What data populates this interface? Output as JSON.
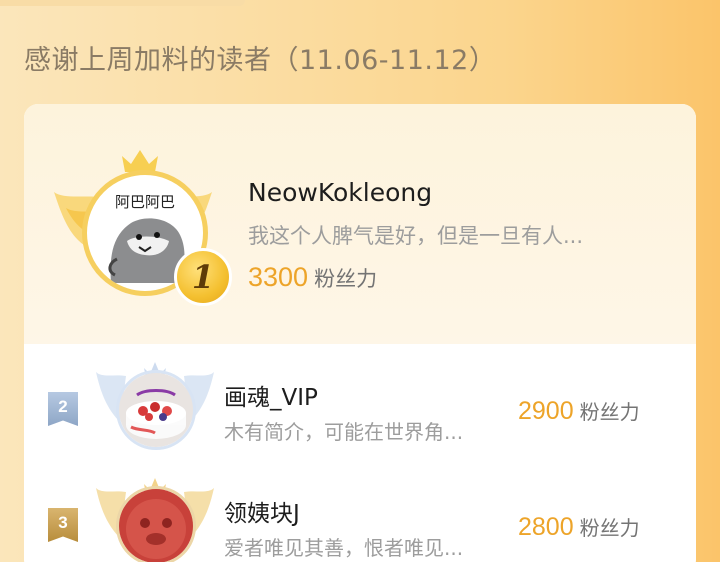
{
  "header": {
    "title": "感谢上周加料的读者（11.06-11.12）"
  },
  "champion": {
    "rank": "1",
    "avatar_text": "阿巴阿巴",
    "name": "NeowKokleong",
    "bio": "我这个人脾气是好，但是一旦有人...",
    "score": "3300",
    "unit": "粉丝力"
  },
  "rows": [
    {
      "rank": "2",
      "name": "画魂_VIP",
      "bio": "木有简介，可能在世界角...",
      "score": "2900",
      "unit": "粉丝力"
    },
    {
      "rank": "3",
      "name": "领姨块J",
      "bio": "爱者唯见其善，恨者唯见...",
      "score": "2800",
      "unit": "粉丝力"
    }
  ],
  "colors": {
    "accent": "#eda429",
    "gold": "#f4c030",
    "silver": "#9fb4d3",
    "bronze": "#c49a4d"
  },
  "icons": {
    "crown": "crown-icon",
    "wings": "laurel-wing-icon",
    "rank_flag": "rank-flag-icon"
  }
}
